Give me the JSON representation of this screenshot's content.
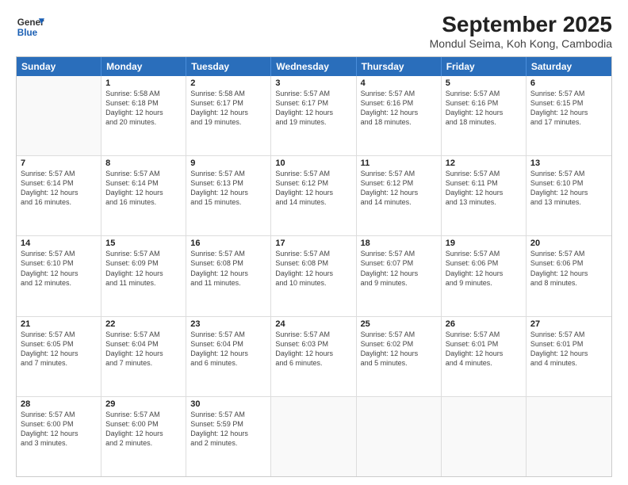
{
  "logo": {
    "line1": "General",
    "line2": "Blue"
  },
  "title": "September 2025",
  "subtitle": "Mondul Seima, Koh Kong, Cambodia",
  "header_days": [
    "Sunday",
    "Monday",
    "Tuesday",
    "Wednesday",
    "Thursday",
    "Friday",
    "Saturday"
  ],
  "weeks": [
    [
      {
        "day": "",
        "info": ""
      },
      {
        "day": "1",
        "info": "Sunrise: 5:58 AM\nSunset: 6:18 PM\nDaylight: 12 hours\nand 20 minutes."
      },
      {
        "day": "2",
        "info": "Sunrise: 5:58 AM\nSunset: 6:17 PM\nDaylight: 12 hours\nand 19 minutes."
      },
      {
        "day": "3",
        "info": "Sunrise: 5:57 AM\nSunset: 6:17 PM\nDaylight: 12 hours\nand 19 minutes."
      },
      {
        "day": "4",
        "info": "Sunrise: 5:57 AM\nSunset: 6:16 PM\nDaylight: 12 hours\nand 18 minutes."
      },
      {
        "day": "5",
        "info": "Sunrise: 5:57 AM\nSunset: 6:16 PM\nDaylight: 12 hours\nand 18 minutes."
      },
      {
        "day": "6",
        "info": "Sunrise: 5:57 AM\nSunset: 6:15 PM\nDaylight: 12 hours\nand 17 minutes."
      }
    ],
    [
      {
        "day": "7",
        "info": "Sunrise: 5:57 AM\nSunset: 6:14 PM\nDaylight: 12 hours\nand 16 minutes."
      },
      {
        "day": "8",
        "info": "Sunrise: 5:57 AM\nSunset: 6:14 PM\nDaylight: 12 hours\nand 16 minutes."
      },
      {
        "day": "9",
        "info": "Sunrise: 5:57 AM\nSunset: 6:13 PM\nDaylight: 12 hours\nand 15 minutes."
      },
      {
        "day": "10",
        "info": "Sunrise: 5:57 AM\nSunset: 6:12 PM\nDaylight: 12 hours\nand 14 minutes."
      },
      {
        "day": "11",
        "info": "Sunrise: 5:57 AM\nSunset: 6:12 PM\nDaylight: 12 hours\nand 14 minutes."
      },
      {
        "day": "12",
        "info": "Sunrise: 5:57 AM\nSunset: 6:11 PM\nDaylight: 12 hours\nand 13 minutes."
      },
      {
        "day": "13",
        "info": "Sunrise: 5:57 AM\nSunset: 6:10 PM\nDaylight: 12 hours\nand 13 minutes."
      }
    ],
    [
      {
        "day": "14",
        "info": "Sunrise: 5:57 AM\nSunset: 6:10 PM\nDaylight: 12 hours\nand 12 minutes."
      },
      {
        "day": "15",
        "info": "Sunrise: 5:57 AM\nSunset: 6:09 PM\nDaylight: 12 hours\nand 11 minutes."
      },
      {
        "day": "16",
        "info": "Sunrise: 5:57 AM\nSunset: 6:08 PM\nDaylight: 12 hours\nand 11 minutes."
      },
      {
        "day": "17",
        "info": "Sunrise: 5:57 AM\nSunset: 6:08 PM\nDaylight: 12 hours\nand 10 minutes."
      },
      {
        "day": "18",
        "info": "Sunrise: 5:57 AM\nSunset: 6:07 PM\nDaylight: 12 hours\nand 9 minutes."
      },
      {
        "day": "19",
        "info": "Sunrise: 5:57 AM\nSunset: 6:06 PM\nDaylight: 12 hours\nand 9 minutes."
      },
      {
        "day": "20",
        "info": "Sunrise: 5:57 AM\nSunset: 6:06 PM\nDaylight: 12 hours\nand 8 minutes."
      }
    ],
    [
      {
        "day": "21",
        "info": "Sunrise: 5:57 AM\nSunset: 6:05 PM\nDaylight: 12 hours\nand 7 minutes."
      },
      {
        "day": "22",
        "info": "Sunrise: 5:57 AM\nSunset: 6:04 PM\nDaylight: 12 hours\nand 7 minutes."
      },
      {
        "day": "23",
        "info": "Sunrise: 5:57 AM\nSunset: 6:04 PM\nDaylight: 12 hours\nand 6 minutes."
      },
      {
        "day": "24",
        "info": "Sunrise: 5:57 AM\nSunset: 6:03 PM\nDaylight: 12 hours\nand 6 minutes."
      },
      {
        "day": "25",
        "info": "Sunrise: 5:57 AM\nSunset: 6:02 PM\nDaylight: 12 hours\nand 5 minutes."
      },
      {
        "day": "26",
        "info": "Sunrise: 5:57 AM\nSunset: 6:01 PM\nDaylight: 12 hours\nand 4 minutes."
      },
      {
        "day": "27",
        "info": "Sunrise: 5:57 AM\nSunset: 6:01 PM\nDaylight: 12 hours\nand 4 minutes."
      }
    ],
    [
      {
        "day": "28",
        "info": "Sunrise: 5:57 AM\nSunset: 6:00 PM\nDaylight: 12 hours\nand 3 minutes."
      },
      {
        "day": "29",
        "info": "Sunrise: 5:57 AM\nSunset: 6:00 PM\nDaylight: 12 hours\nand 2 minutes."
      },
      {
        "day": "30",
        "info": "Sunrise: 5:57 AM\nSunset: 5:59 PM\nDaylight: 12 hours\nand 2 minutes."
      },
      {
        "day": "",
        "info": ""
      },
      {
        "day": "",
        "info": ""
      },
      {
        "day": "",
        "info": ""
      },
      {
        "day": "",
        "info": ""
      }
    ]
  ]
}
